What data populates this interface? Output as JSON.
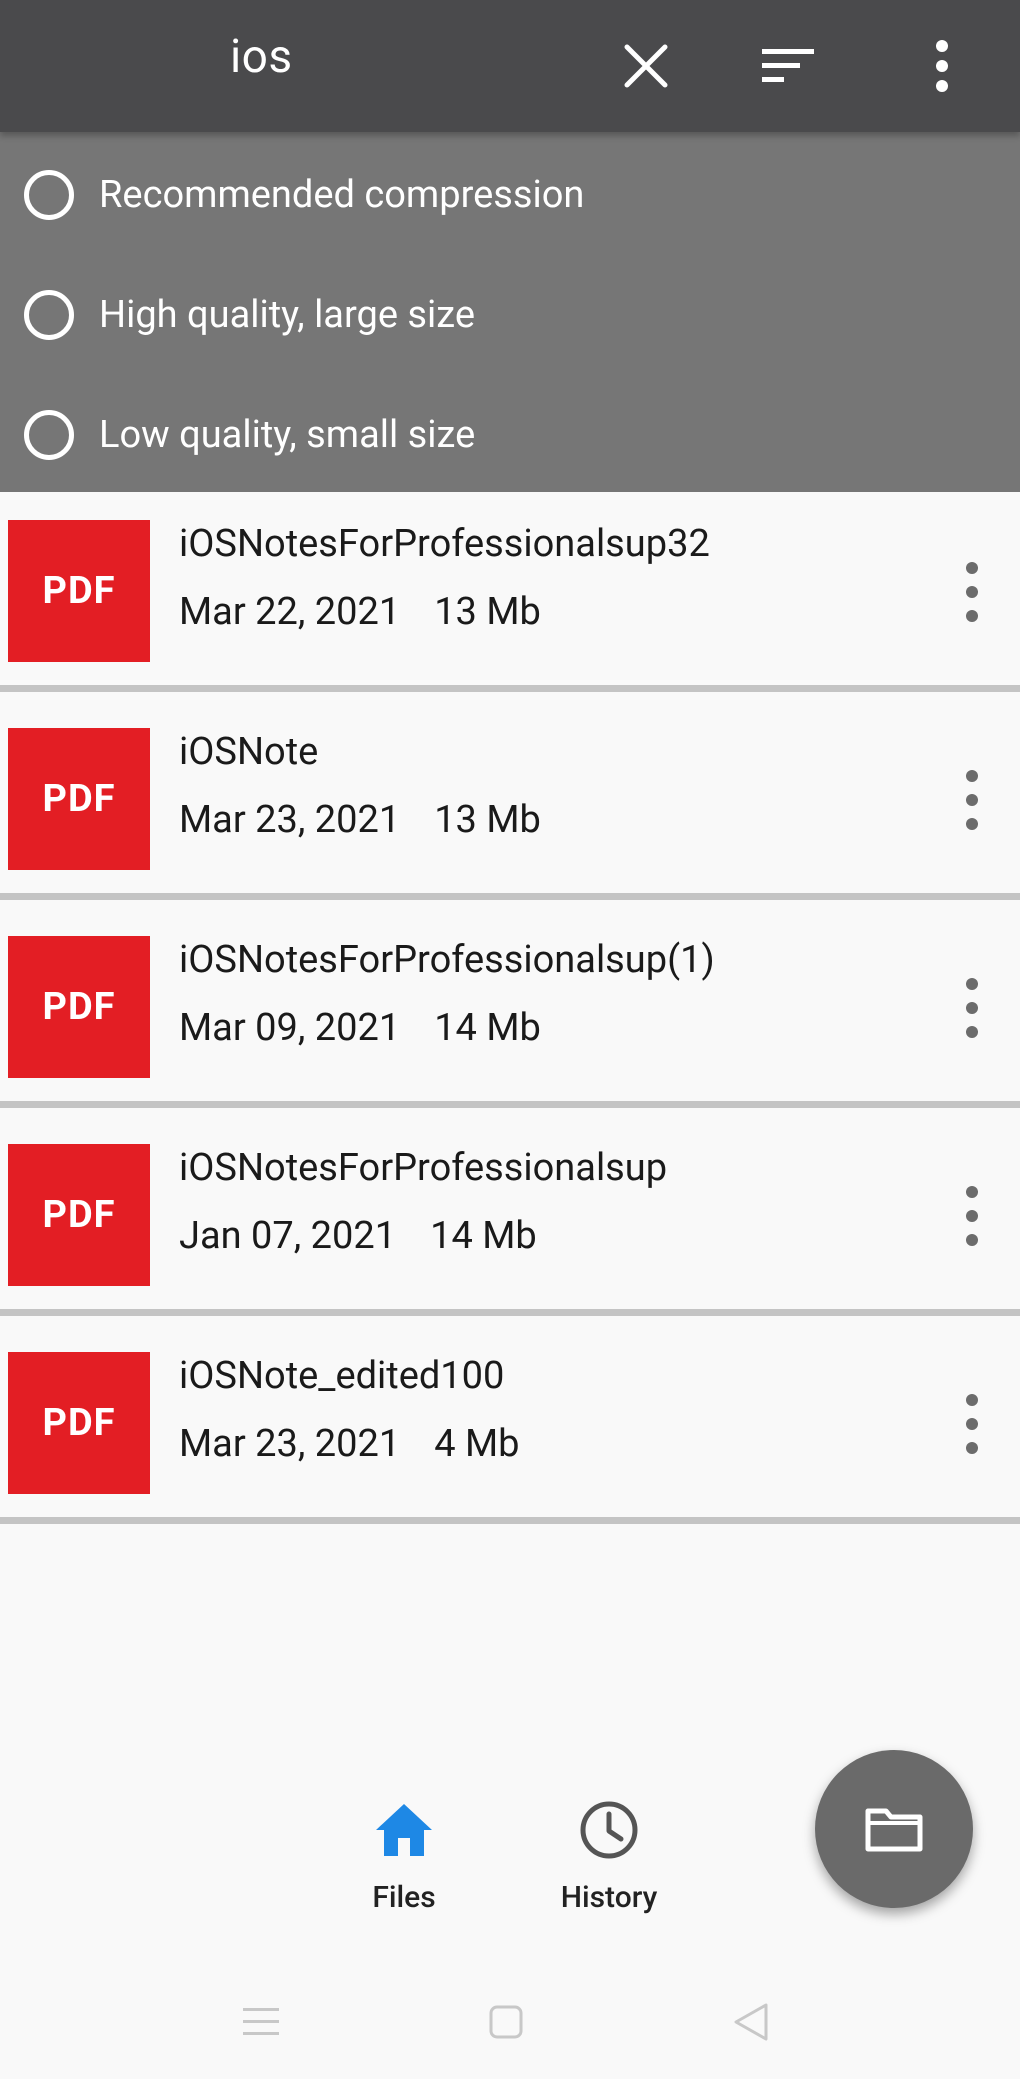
{
  "appbar": {
    "search_query": "ios",
    "icons": [
      "close-icon",
      "sort-icon",
      "more-vert-icon"
    ]
  },
  "compression_options": [
    {
      "label": "Recommended compression",
      "selected": false
    },
    {
      "label": "High quality, large size",
      "selected": false
    },
    {
      "label": "Low quality, small size",
      "selected": false
    }
  ],
  "files": [
    {
      "thumb_label": "PDF",
      "name": "iOSNotesForProfessionalsup32",
      "date": "Mar 22, 2021",
      "size": "13 Mb"
    },
    {
      "thumb_label": "PDF",
      "name": "iOSNote",
      "date": "Mar 23, 2021",
      "size": "13 Mb"
    },
    {
      "thumb_label": "PDF",
      "name": "iOSNotesForProfessionalsup(1)",
      "date": "Mar 09, 2021",
      "size": "14 Mb"
    },
    {
      "thumb_label": "PDF",
      "name": "iOSNotesForProfessionalsup",
      "date": "Jan 07, 2021",
      "size": "14 Mb"
    },
    {
      "thumb_label": "PDF",
      "name": "iOSNote_edited100",
      "date": "Mar 23, 2021",
      "size": "4 Mb"
    }
  ],
  "bottom_nav": {
    "items": [
      {
        "label": "Files",
        "icon": "home-icon",
        "active": true
      },
      {
        "label": "History",
        "icon": "clock-icon",
        "active": false
      }
    ]
  },
  "fab": {
    "icon": "folder-icon"
  },
  "colors": {
    "appbar": "#4a4a4c",
    "options_panel": "#767676",
    "pdf_red": "#e31e24",
    "active_nav": "#1e88e5"
  }
}
